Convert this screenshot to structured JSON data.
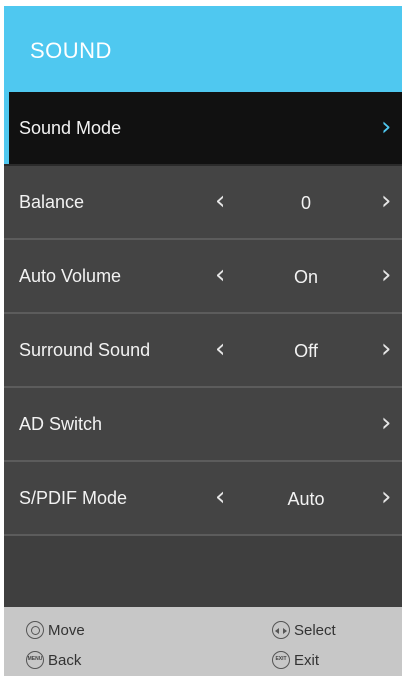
{
  "header": {
    "title": "SOUND"
  },
  "menu": [
    {
      "label": "Sound Mode",
      "value": null,
      "has_left_arrow": false,
      "selected": true
    },
    {
      "label": "Balance",
      "value": "0",
      "has_left_arrow": true,
      "selected": false
    },
    {
      "label": "Auto Volume",
      "value": "On",
      "has_left_arrow": true,
      "selected": false
    },
    {
      "label": "Surround Sound",
      "value": "Off",
      "has_left_arrow": true,
      "selected": false
    },
    {
      "label": "AD Switch",
      "value": null,
      "has_left_arrow": false,
      "selected": false
    },
    {
      "label": "S/PDIF Mode",
      "value": "Auto",
      "has_left_arrow": true,
      "selected": false
    }
  ],
  "arrows": {
    "left": "‹",
    "right": "›"
  },
  "footer": {
    "move_label": "Move",
    "select_label": "Select",
    "back_label": "Back",
    "exit_label": "Exit",
    "menu_key_text": "MENU",
    "exit_key_text": "EXIT"
  },
  "colors": {
    "accent": "#4fc8f0",
    "panel": "#444444",
    "selected": "#111111",
    "footer": "#c7c7c7"
  }
}
